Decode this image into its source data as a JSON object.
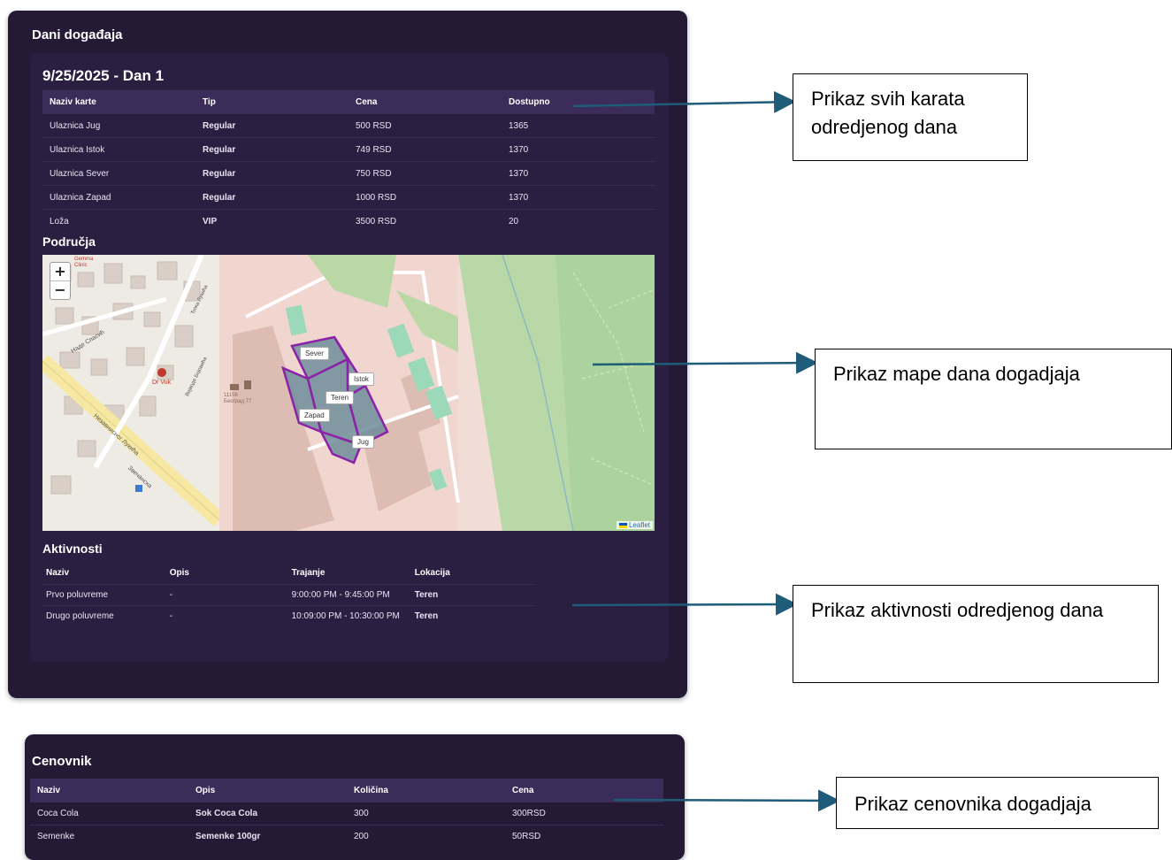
{
  "event_days": {
    "title": "Dani događaja",
    "day_title": "9/25/2025 - Dan 1",
    "tickets": {
      "headers": [
        "Naziv karte",
        "Tip",
        "Cena",
        "Dostupno"
      ],
      "rows": [
        [
          "Ulaznica Jug",
          "Regular",
          "500 RSD",
          "1365"
        ],
        [
          "Ulaznica Istok",
          "Regular",
          "749 RSD",
          "1370"
        ],
        [
          "Ulaznica Sever",
          "Regular",
          "750 RSD",
          "1370"
        ],
        [
          "Ulaznica Zapad",
          "Regular",
          "1000 RSD",
          "1370"
        ],
        [
          "Loža",
          "VIP",
          "3500 RSD",
          "20"
        ]
      ]
    },
    "areas_title": "Područja",
    "map": {
      "zoom_in": "+",
      "zoom_out": "−",
      "attribution": "Leaflet",
      "zone_labels": {
        "sever": "Sever",
        "istok": "Istok",
        "teren": "Teren",
        "zapad": "Zapad",
        "jug": "Jug"
      },
      "place_labels": {
        "clinic": "Gemma Clinic",
        "dr_vuk": "Dr Vuk",
        "post": "11156 Београд 77",
        "street1": "Наде Спасић",
        "street2": "Војводе Бојовића",
        "street3": "Ђока Лукића",
        "street4": "Звечанска",
        "street5": "Незавнисног Лукића"
      },
      "colors": {
        "zone_stroke": "#8b22a7",
        "zone_fill": "#6f8d9a",
        "park": "#b8d8a8"
      }
    },
    "activities": {
      "title": "Aktivnosti",
      "headers": [
        "Naziv",
        "Opis",
        "Trajanje",
        "Lokacija"
      ],
      "rows": [
        [
          "Prvo poluvreme",
          "-",
          "9:00:00 PM - 9:45:00 PM",
          "Teren"
        ],
        [
          "Drugo poluvreme",
          "-",
          "10:09:00 PM - 10:30:00 PM",
          "Teren"
        ]
      ]
    }
  },
  "price_list": {
    "title": "Cenovnik",
    "headers": [
      "Naziv",
      "Opis",
      "Količina",
      "Cena"
    ],
    "rows": [
      [
        "Coca Cola",
        "Sok Coca Cola",
        "300",
        "300RSD"
      ],
      [
        "Semenke",
        "Semenke 100gr",
        "200",
        "50RSD"
      ]
    ]
  },
  "callouts": {
    "tickets": "Prikaz svih karata odredjenog dana",
    "map": "Prikaz mape dana dogadjaja",
    "activities": "Prikaz aktivnosti odredjenog dana",
    "price_list": "Prikaz cenovnika dogadjaja"
  },
  "colors": {
    "panel_bg": "#241a36",
    "header_bg": "#3c2c5a",
    "arrow": "#1f5c7a"
  }
}
